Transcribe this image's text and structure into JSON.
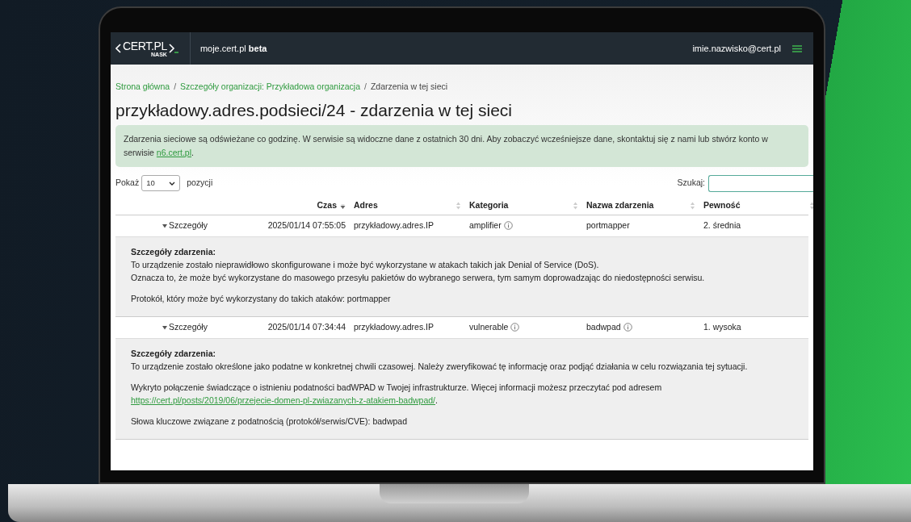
{
  "navbar": {
    "logo": "CERT.PL",
    "logo_sub": "NASK",
    "site": "moje.cert.pl",
    "site_badge": "beta",
    "user": "imie.nazwisko@cert.pl"
  },
  "breadcrumbs": [
    {
      "label": "Strona główna",
      "kind": "link"
    },
    {
      "label": "/",
      "kind": "separator"
    },
    {
      "label": "Szczegóły organizacji: Przykładowa organizacja",
      "kind": "link"
    },
    {
      "label": "/",
      "kind": "separator"
    },
    {
      "label": "Zdarzenia w tej sieci",
      "kind": "current"
    }
  ],
  "title": "przykładowy.adres.podsieci/24 - zdarzenia w tej sieci",
  "alert": {
    "text": "Zdarzenia sieciowe są odświeżane co godzinę. W serwisie są widoczne dane z ostatnich 30 dni. Aby zobaczyć wcześniejsze dane, skontaktuj się z nami lub stwórz konto w serwisie ",
    "link": "n6.cert.pl",
    "after": "."
  },
  "length": {
    "label": "Pokaż",
    "value": "10",
    "suffix": "pozycji"
  },
  "search": {
    "label": "Szukaj:"
  },
  "columns": [
    {
      "label": "Czas",
      "sorted": true
    },
    {
      "label": "Adres",
      "sorted": false
    },
    {
      "label": "Kategoria",
      "sorted": false
    },
    {
      "label": "Nazwa zdarzenia",
      "sorted": false
    },
    {
      "label": "Pewność",
      "sorted": false
    }
  ],
  "rows": [
    {
      "toggle": "Szczegóły",
      "expanded": true,
      "time": "2025/01/14 07:55:05",
      "address": "przykładowy.adres.IP",
      "category": "amplifier",
      "category_info": true,
      "name": "portmapper",
      "name_info": false,
      "certainty": "2. średnia",
      "details": {
        "heading": "Szczegóły zdarzenia:",
        "paragraphs": [
          [
            {
              "text": "To urządzenie zostało nieprawidłowo skonfigurowane i może być wykorzystane w atakach takich jak Denial of Service (DoS).",
              "link": false
            },
            {
              "text": "Oznacza to, że może być wykorzystane do masowego przesyłu pakietów do wybranego serwera, tym samym doprowadzając do niedostępności serwisu.",
              "link": false
            }
          ],
          [
            {
              "text": "Protokół, który może być wykorzystany do takich ataków: portmapper",
              "link": false
            }
          ]
        ]
      }
    },
    {
      "toggle": "Szczegóły",
      "expanded": true,
      "time": "2025/01/14 07:34:44",
      "address": "przykładowy.adres.IP",
      "category": "vulnerable",
      "category_info": true,
      "name": "badwpad",
      "name_info": true,
      "certainty": "1. wysoka",
      "details": {
        "heading": "Szczegóły zdarzenia:",
        "paragraphs": [
          [
            {
              "text": "To urządzenie zostało określone jako podatne w konkretnej chwili czasowej. Należy zweryfikować tę informację oraz podjąć działania w celu rozwiązania tej sytuacji.",
              "link": false
            }
          ],
          [
            {
              "text": "Wykryto połączenie świadczące o istnieniu podatności badWPAD w Twojej infrastrukturze. Więcej informacji możesz przeczytać pod adresem",
              "link": false
            },
            {
              "text": "https://cert.pl/posts/2019/06/przejecie-domen-pl-zwiazanych-z-atakiem-badwpad/",
              "link": true,
              "after": "."
            }
          ],
          [
            {
              "text": "Słowa kluczowe związane z podatnością (protokół/serwis/CVE): badwpad",
              "link": false
            }
          ]
        ]
      }
    }
  ]
}
